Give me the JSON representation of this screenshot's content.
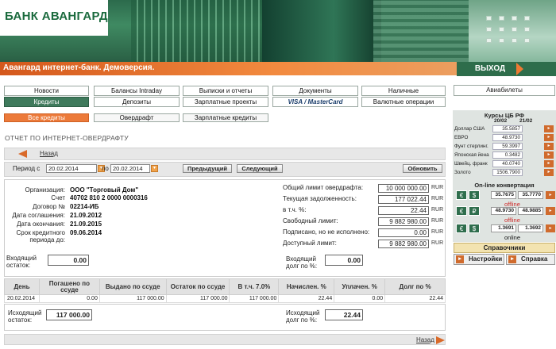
{
  "header": {
    "logo": "БАНК АВАНГАРД"
  },
  "topbar": {
    "title": "Авангард интернет-банк. Демоверсия.",
    "exit": "ВЫХОД"
  },
  "nav": {
    "row1": [
      "Новости",
      "Балансы Intraday",
      "Выписки и отчеты",
      "Документы",
      "Наличные"
    ],
    "row2": [
      "Кредиты",
      "Депозиты",
      "Зарплатные проекты",
      "VISA / MasterCard",
      "Валютные операции"
    ],
    "active": "Кредиты"
  },
  "subnav": {
    "items": [
      "Все кредиты",
      "Овердрафт",
      "Зарплатные кредиты"
    ],
    "active": "Все кредиты"
  },
  "page_title": "ОТЧЕТ ПО ИНТЕРНЕТ-ОВЕРДРАФТУ",
  "back_link": "Назад",
  "period": {
    "from_label": "Период с",
    "from": "20.02.2014",
    "to_label": "по",
    "to": "20.02.2014",
    "prev": "Предыдущий",
    "next": "Следующий",
    "refresh": "Обновить"
  },
  "info": {
    "org_label": "Организация:",
    "org": "ООО \"Торговый Дом\"",
    "acct_label": "Счет",
    "acct": "40702 810 2 0000 0000316",
    "contract_label": "Договор №",
    "contract": "02214-ИБ",
    "signed_label": "Дата соглашения:",
    "signed": "21.09.2012",
    "end_label": "Дата окончания:",
    "end": "21.09.2015",
    "term_label": "Срок кредитного периода до:",
    "term": "09.06.2014",
    "open_in_label": "Входящий остаток:",
    "open_in": "0.00",
    "total_label": "Общий лимит овердрафта:",
    "total": "10 000 000.00",
    "debt_label": "Текущая задолженность:",
    "debt": "177 022.44",
    "incl_label": "в т.ч. %:",
    "incl": "22.44",
    "free_label": "Свободный лимит:",
    "free": "9 882 980.00",
    "signed_unexec_label": "Подписано, но не исполнено:",
    "signed_unexec": "0.00",
    "avail_label": "Доступный лимит:",
    "avail": "9 882 980.00",
    "open_debt_label": "Входящий долг по %:",
    "open_debt": "0.00",
    "cur": "RUR"
  },
  "table": {
    "headers": [
      "День",
      "Погашено по ссуде",
      "Выдано по ссуде",
      "Остаток по ссуде",
      "В т.ч. 7.0%",
      "Начислен. %",
      "Уплачен. %",
      "Долг по %"
    ],
    "rows": [
      [
        "20.02.2014",
        "0.00",
        "117 000.00",
        "117 000.00",
        "117 000.00",
        "22.44",
        "0.00",
        "22.44"
      ]
    ]
  },
  "footer": {
    "close_label": "Исходящий остаток:",
    "close": "117 000.00",
    "close_debt_label": "Исходящий долг по %:",
    "close_debt": "22.44",
    "back_link": "Назад"
  },
  "sidebar": {
    "avia": "Авиабилеты",
    "rates_title": "Курсы ЦБ РФ",
    "dates": [
      "20/02",
      "21/02"
    ],
    "rates": [
      {
        "name": "Доллар США",
        "value": "35.5857"
      },
      {
        "name": "ЕВРО",
        "value": "48.9730"
      },
      {
        "name": "Фунт стерлинг.",
        "value": "59.3997"
      },
      {
        "name": "Японская йена",
        "value": "0.3482"
      },
      {
        "name": "Швейц. франк",
        "value": "40.0740"
      },
      {
        "name": "Золото",
        "value": "1506.7900"
      }
    ],
    "online_title": "On-line конвертация",
    "conv": [
      {
        "buy": "35.7675",
        "sell": "35.7770",
        "status": "offline"
      },
      {
        "buy": "48.9730",
        "sell": "48.9885",
        "status": "offline"
      },
      {
        "buy": "1.3691",
        "sell": "1.3692",
        "status": "online"
      }
    ],
    "reference": "Справочники",
    "settings": "Настройки",
    "help": "Справка"
  }
}
